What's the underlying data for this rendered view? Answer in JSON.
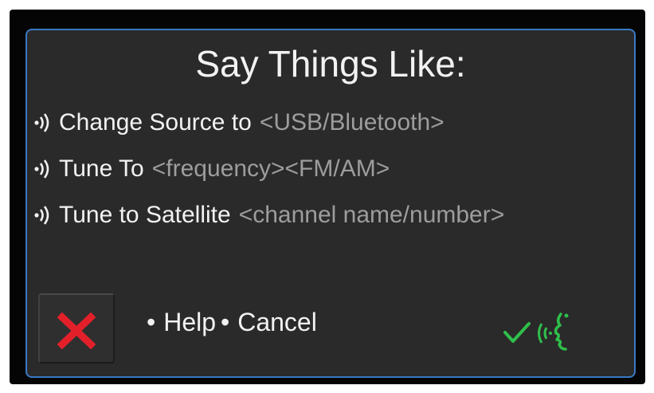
{
  "dialog": {
    "title": "Say Things Like:",
    "commands": [
      {
        "text": "Change Source to",
        "param": "<USB/Bluetooth>",
        "icon": "voice-command-icon"
      },
      {
        "text": "Tune To",
        "param": "<frequency><FM/AM>",
        "icon": "voice-command-icon"
      },
      {
        "text": "Tune to Satellite",
        "param": "<channel name/number>",
        "icon": "voice-command-icon"
      }
    ],
    "options": {
      "bullet": "•",
      "help_label": "Help",
      "cancel_label": "Cancel"
    },
    "cancel_button": {
      "icon": "close-icon",
      "color": "#e3202a"
    },
    "status": {
      "check_icon": "checkmark-icon",
      "speaker_icon": "voice-recognition-icon",
      "color": "#2fbf4a"
    },
    "colors": {
      "background": "#2a2a2a",
      "border": "#3a79c4",
      "text": "#f2f2f2",
      "param_text": "#9d9d9d"
    }
  }
}
